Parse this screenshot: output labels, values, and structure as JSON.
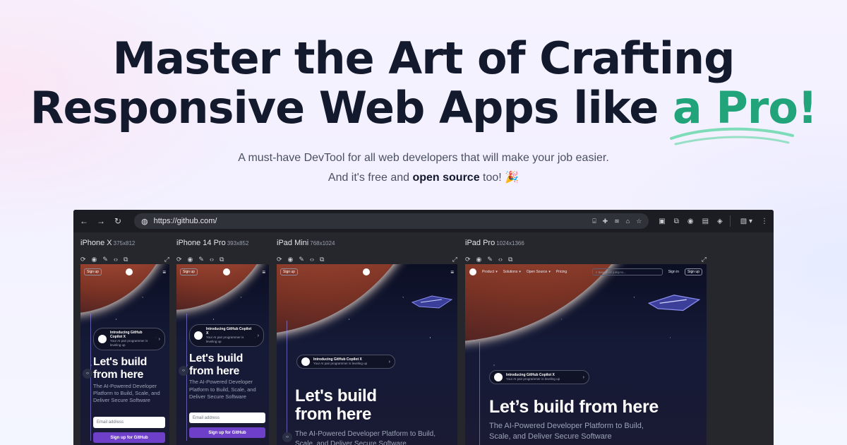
{
  "hero": {
    "headline_line1": "Master the Art of Crafting",
    "headline_line2_prefix": "Responsive Web Apps like ",
    "headline_accent": "a Pro!",
    "sub_line1": "A must-have DevTool for all web developers that will make your job easier.",
    "sub_line2_prefix": "And it's free and ",
    "sub_line2_bold": "open source",
    "sub_line2_suffix": " too! 🎉"
  },
  "colors": {
    "accent": "#21a47a",
    "headline": "#141a2e",
    "browser_bg": "#25272d",
    "cta": "#6e40c9"
  },
  "browser": {
    "url": "https://github.com/",
    "nav_icons": [
      "back-icon",
      "forward-icon",
      "reload-icon"
    ]
  },
  "devices": [
    {
      "name": "iPhone X",
      "dims": "375x812"
    },
    {
      "name": "iPhone 14 Pro",
      "dims": "393x852"
    },
    {
      "name": "iPad Mini",
      "dims": "768x1024"
    },
    {
      "name": "iPad Pro",
      "dims": "1024x1366"
    }
  ],
  "site": {
    "signup": "Sign up",
    "signin": "Sign in",
    "nav_product": "Product",
    "nav_solutions": "Solutions",
    "nav_open_source": "Open Source",
    "nav_pricing": "Pricing",
    "search_placeholder": "Search or jump to...",
    "copilot_title": "Introducing GitHub Copilot X",
    "copilot_sub": "Your AI pair programmer is leveling up",
    "hero_line1": "Let's build",
    "hero_line2": "from here",
    "hero_full": "Let’s build from here",
    "tagline": "The AI-Powered Developer Platform to Build, Scale, and Deliver Secure Software",
    "email_placeholder": "Email address",
    "cta": "Sign up for GitHub"
  }
}
